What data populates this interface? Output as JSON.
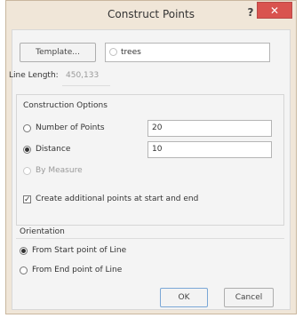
{
  "title": "Construct Points",
  "titlebar": {
    "help": "?",
    "close": "✕"
  },
  "template": {
    "button_label": "Template...",
    "value": "trees"
  },
  "line_length": {
    "label": "Line Length:",
    "value": "450,133"
  },
  "construction_options": {
    "header": "Construction Options",
    "number_of_points": {
      "label": "Number of Points",
      "value": "20",
      "selected": false
    },
    "distance": {
      "label": "Distance",
      "value": "10",
      "selected": true
    },
    "by_measure": {
      "label": "By Measure",
      "enabled": false
    },
    "create_additional": {
      "label": "Create additional points at start and end",
      "checked": true
    }
  },
  "orientation": {
    "header": "Orientation",
    "from_start": {
      "label": "From Start point of Line",
      "selected": true
    },
    "from_end": {
      "label": "From End point of Line",
      "selected": false
    }
  },
  "buttons": {
    "ok": "OK",
    "cancel": "Cancel"
  }
}
